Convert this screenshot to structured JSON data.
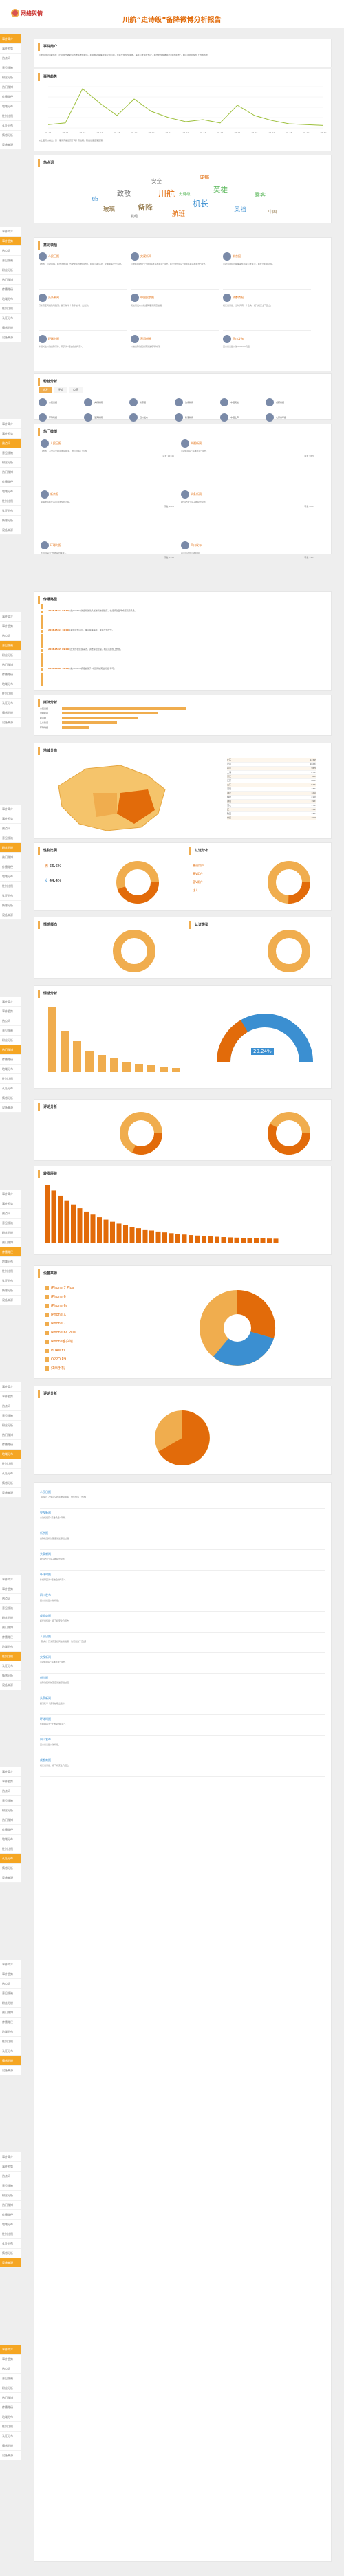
{
  "header": {
    "logo_text": "网络舆情",
    "title": "川航“史诗级”备降微博分析报告"
  },
  "colors": {
    "accent": "#f0ad4e",
    "orange": "#e26b0a",
    "red": "#c9302c"
  },
  "sidebar_items": [
    "事件简介",
    "事件趋势",
    "热点词",
    "意见领袖",
    "粉丝分析",
    "热门微博",
    "传播路径",
    "地域分布",
    "性别比例",
    "认证分布",
    "情感分析",
    "设备来源",
    "评论分析",
    "转发层级"
  ],
  "intro": {
    "title": "事件简介",
    "text": "川航3U8633航班在飞行途中驾驶舱风挡玻璃破裂脱落，机组成功备降成都双流机场，乘客全部安全落地。事件引发网友热议，机长刘传健被称为“中国机长”，相关话题持续登上微博热搜。"
  },
  "trend": {
    "title": "事件趋势",
    "desc": "从上图可以看出，整个事件传播经历了两个高峰期，随后热度逐渐回落。",
    "xlabels": [
      "05-14",
      "05-15",
      "05-16",
      "05-17",
      "05-18",
      "05-19",
      "05-20",
      "05-21",
      "05-22",
      "05-23",
      "05-24",
      "05-25",
      "05-26",
      "05-27",
      "05-28",
      "05-29",
      "05-30"
    ],
    "series": [
      8,
      12,
      95,
      60,
      30,
      70,
      40,
      25,
      15,
      20,
      12,
      55,
      30,
      18,
      10,
      8,
      6
    ]
  },
  "wordcloud": {
    "title": "热点词",
    "words": [
      "川航",
      "机长",
      "备降",
      "英雄",
      "致敬",
      "航班",
      "风挡",
      "玻璃",
      "乘客",
      "安全",
      "成都",
      "飞行",
      "中国",
      "史诗级",
      "机组"
    ]
  },
  "leaders": {
    "title": "意见领袖",
    "users": [
      {
        "name": "人民日报",
        "text": "【致敬！川航备降，机长这样说】驾驶舱风挡玻璃破裂，机组沉着应对，全体乘客安全落地。"
      },
      {
        "name": "央视新闻",
        "text": "川航机组被授予“中国民航英雄机组”称号，机长刘传健获“中国民航英雄机长”称号。"
      },
      {
        "name": "新京报",
        "text": "川航3U8633备降事件持续引发关注，网友为机组点赞。"
      },
      {
        "name": "头条新闻",
        "text": "万米高空风挡玻璃脱落，副驾驶半个身子被“吸”出窗外。"
      },
      {
        "name": "中国民航报",
        "text": "民航局发布川航备降事件调查进展。"
      },
      {
        "name": "成都商报",
        "text": "机长刘传健：当时只有一个念头，把飞机安全飞回去。"
      },
      {
        "name": "环球时报",
        "text": "外媒关注川航备降事件，称其为“奇迹般的降落”。"
      },
      {
        "name": "澎湃新闻",
        "text": "川航备降航班乘客讲述惊魂时刻。"
      },
      {
        "name": "四川发布",
        "text": "四川省表彰川航3U8633机组。"
      }
    ]
  },
  "fans": {
    "title": "粉丝分析",
    "tabs": [
      "转发",
      "评论",
      "点赞"
    ],
    "items": [
      "人民日报",
      "央视新闻",
      "新京报",
      "头条新闻",
      "中国民航",
      "成都商报",
      "环球时报",
      "澎湃新闻",
      "四川发布",
      "新浪新闻",
      "中国之声",
      "北京青年报"
    ]
  },
  "hot": {
    "title": "热门微博",
    "items": [
      {
        "name": "人民日报",
        "text": "【致敬！万米高空挡风玻璃脱落，他们创造了奇迹】",
        "meta": "转发 12345"
      },
      {
        "name": "央视新闻",
        "text": "川航机组获“英雄机组”称号。",
        "meta": "转发 9876"
      },
      {
        "name": "新京报",
        "text": "备降航班机长首度讲述惊险过程。",
        "meta": "转发 7654"
      },
      {
        "name": "头条新闻",
        "text": "副驾驶半个身子被吸出窗外。",
        "meta": "转发 6543"
      },
      {
        "name": "环球时报",
        "text": "外媒称其为“奇迹般的降落”。",
        "meta": "转发 5432"
      },
      {
        "name": "四川发布",
        "text": "四川省表彰川航机组。",
        "meta": "转发 4321"
      },
      {
        "name": "成都商报",
        "text": "机长刘传健：把飞机安全飞回去。",
        "meta": "转发 3210"
      }
    ]
  },
  "timeline": {
    "title": "传播路径",
    "items": [
      {
        "time": "2018-05-14 07:39",
        "text": "川航3U8633航班驾驶舱风挡玻璃破裂脱落，机组紧急备降成都双流机场。"
      },
      {
        "time": "2018-05-14 10:00",
        "text": "民航局发布消息，确认备降事件，乘客全部安全。"
      },
      {
        "time": "2018-05-15 09:00",
        "text": "机长刘传健接受采访，讲述惊险过程，相关话题登上热搜。"
      },
      {
        "time": "2018-06-08 10:00",
        "text": "川航3U8633机组被授予“中国民航英雄机组”称号。"
      }
    ]
  },
  "media": {
    "title": "媒体分析",
    "items": [
      "人民日报",
      "央视新闻",
      "新京报",
      "头条新闻",
      "环球时报"
    ],
    "values": [
      90,
      70,
      55,
      40,
      20
    ]
  },
  "geo": {
    "title": "地域分布",
    "rows": [
      [
        "广东",
        "12345"
      ],
      [
        "北京",
        "10234"
      ],
      [
        "四川",
        "9876"
      ],
      [
        "上海",
        "8765"
      ],
      [
        "浙江",
        "7654"
      ],
      [
        "江苏",
        "6543"
      ],
      [
        "山东",
        "5432"
      ],
      [
        "河南",
        "4321"
      ],
      [
        "湖北",
        "3210"
      ],
      [
        "福建",
        "2109"
      ],
      [
        "湖南",
        "1987"
      ],
      [
        "河北",
        "1765"
      ],
      [
        "辽宁",
        "1543"
      ],
      [
        "陕西",
        "1321"
      ],
      [
        "重庆",
        "1098"
      ]
    ]
  },
  "gender": {
    "title": "性别比例",
    "male": "55.6%",
    "female": "44.4%",
    "male_label": "男",
    "female_label": "女"
  },
  "verify": {
    "title": "认证分布",
    "labels": [
      "普通用户",
      "黄V用户",
      "蓝V用户",
      "达人"
    ]
  },
  "charts_row": {
    "a": "情感倾向",
    "b": "认证类型"
  },
  "sentiment": {
    "title": "情感分析",
    "labels": [
      "正面",
      "中性",
      "负面"
    ]
  },
  "device": {
    "title": "设备来源",
    "items": [
      "iPhone 7 Plus",
      "iPhone 6",
      "iPhone 6s",
      "iPhone X",
      "iPhone 7",
      "iPhone 6s Plus",
      "iPhone客户端",
      "HUAWEI",
      "OPPO R9",
      "红米手机"
    ]
  },
  "comments": {
    "title": "评论分析"
  },
  "gauge": {
    "value": "29.24%",
    "label": "敏感"
  },
  "histogram": {
    "title": "转发层级"
  }
}
